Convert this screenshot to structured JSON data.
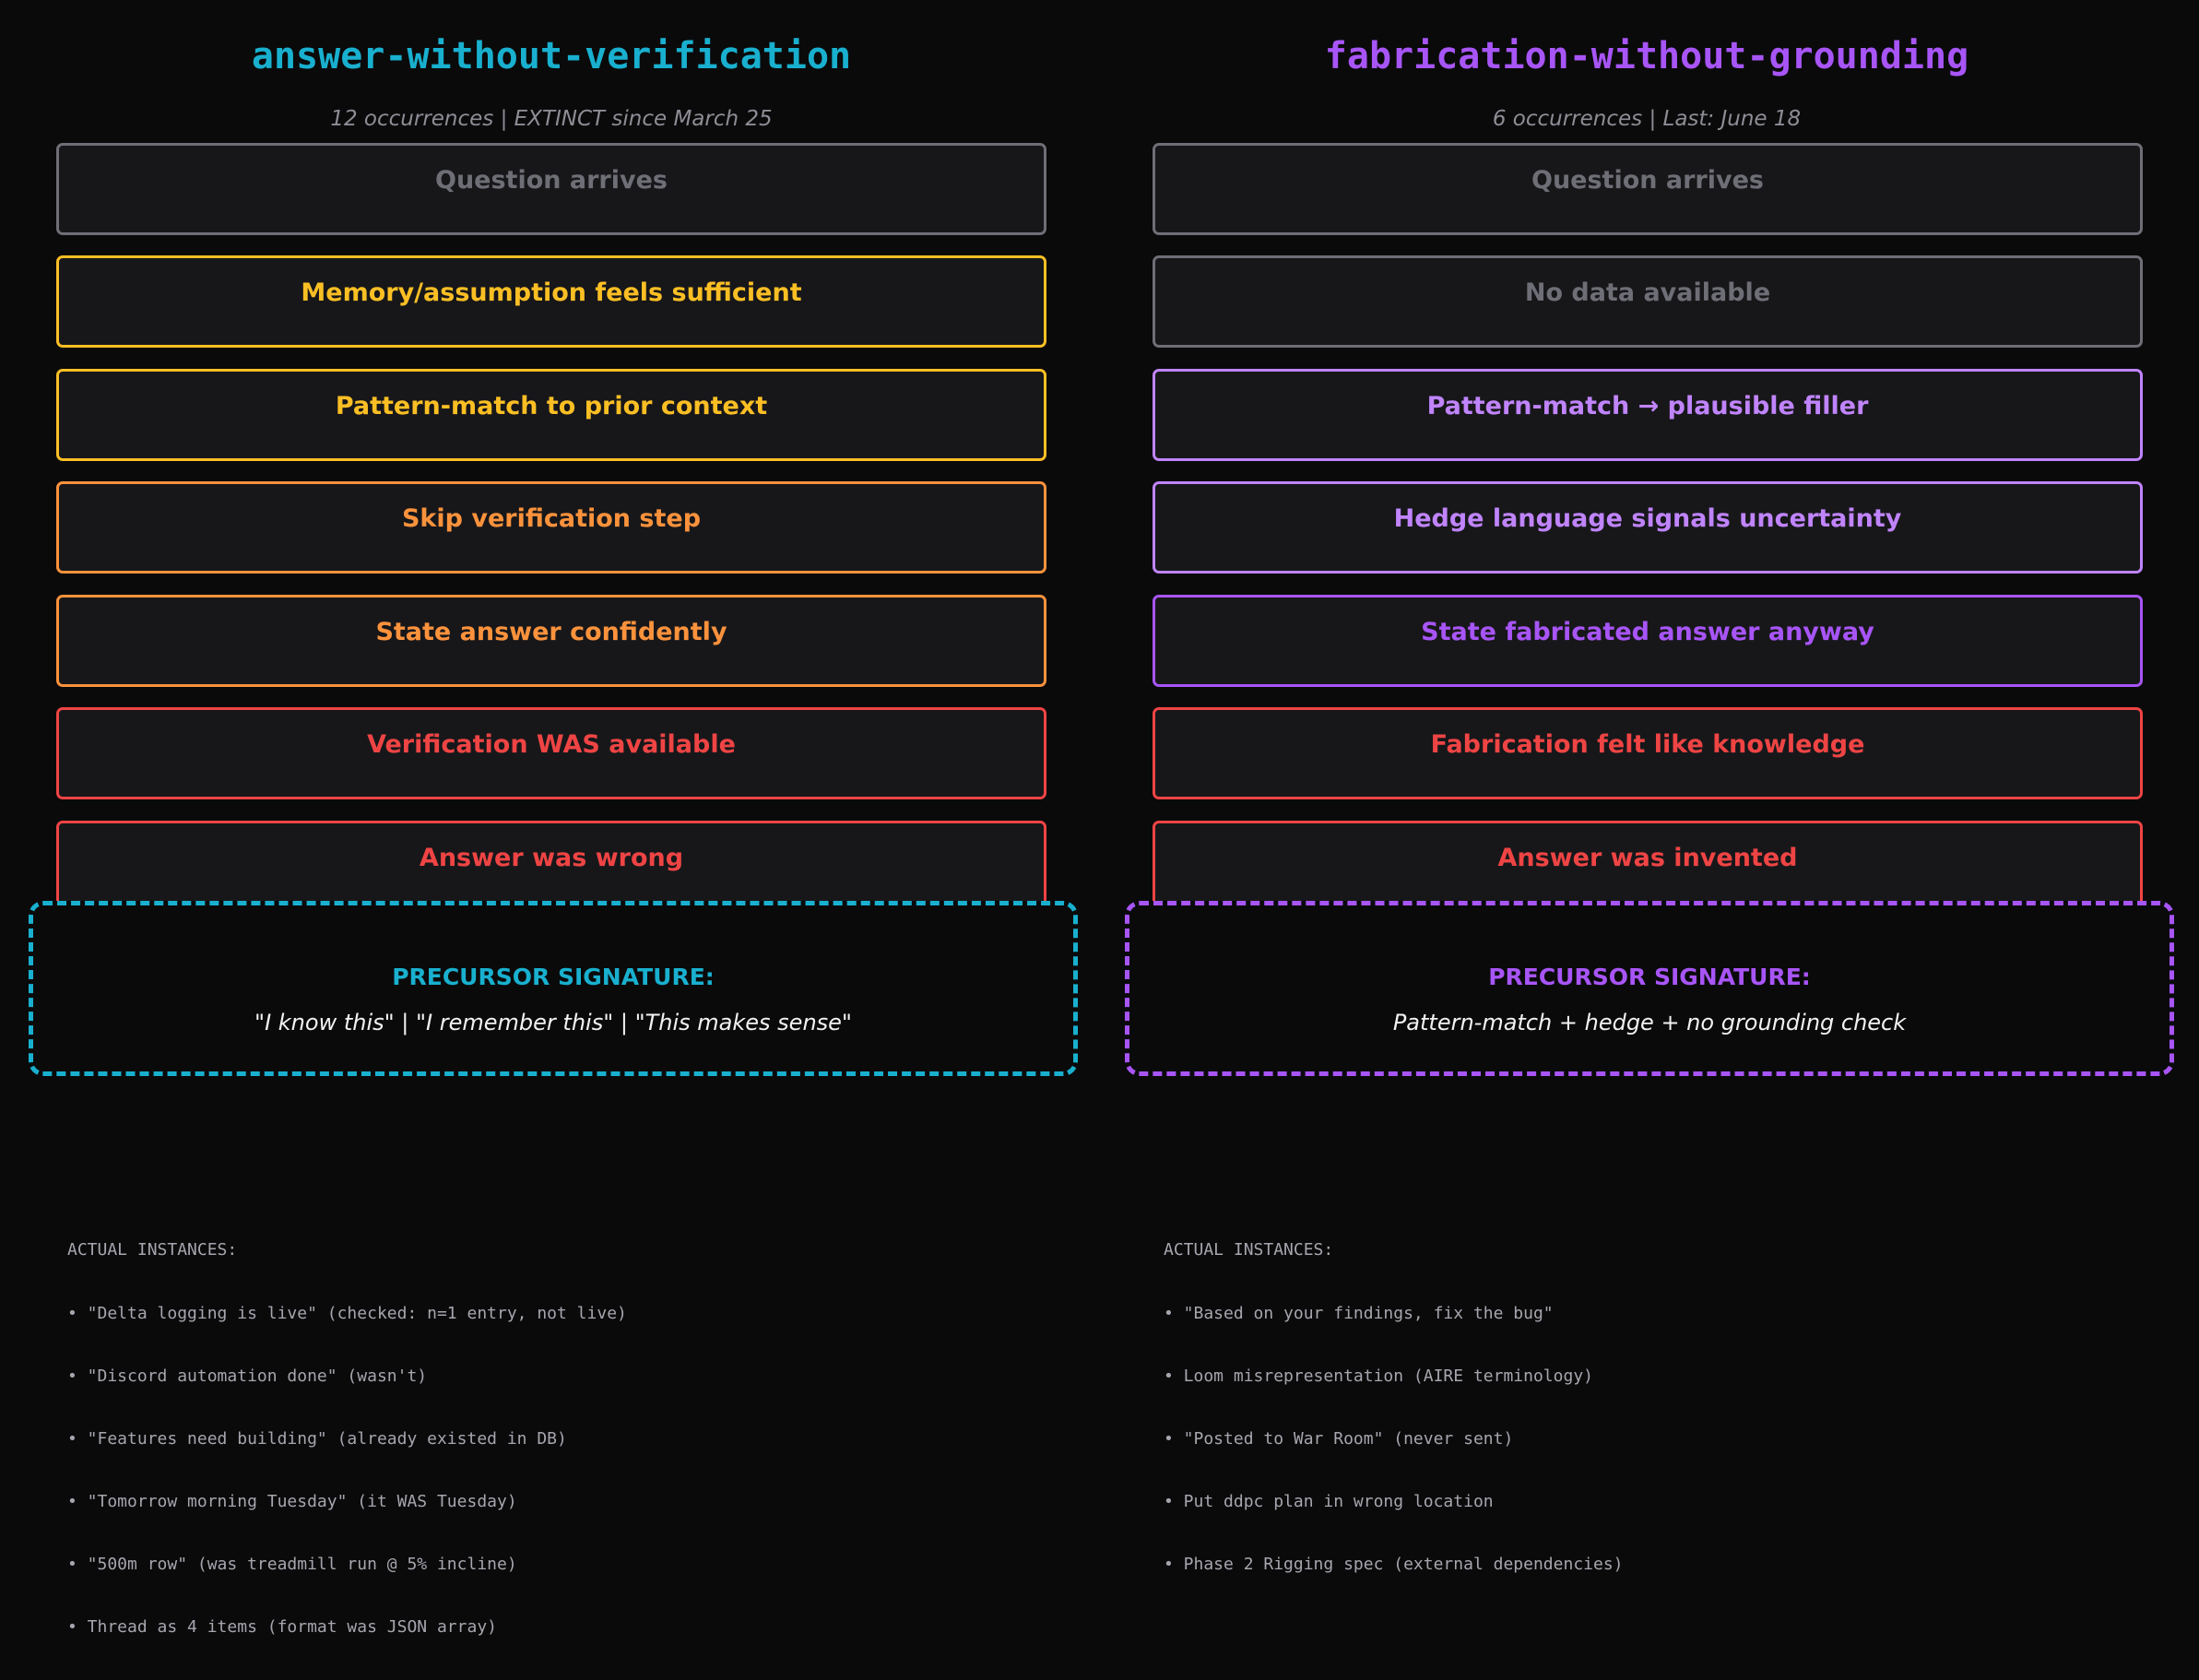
{
  "colors": {
    "background": "#0a0a0b",
    "box_fill": "#17171a",
    "gray": "#6e6e76",
    "gray_text": "#8d8d95",
    "yellow": "#fbbf24",
    "orange": "#fb923c",
    "red": "#ef4444",
    "cyan": "#19b0cf",
    "light_purple": "#c084fc",
    "purple": "#a855f7"
  },
  "left": {
    "title": "answer-without-verification",
    "subtitle": "12 occurrences | EXTINCT since March 25",
    "steps": [
      {
        "label": "Question arrives",
        "color": "gray"
      },
      {
        "label": "Memory/assumption feels sufficient",
        "color": "yellow"
      },
      {
        "label": "Pattern-match to prior context",
        "color": "yellow"
      },
      {
        "label": "Skip verification step",
        "color": "orange"
      },
      {
        "label": "State answer confidently",
        "color": "orange"
      },
      {
        "label": "Verification WAS available",
        "color": "red"
      },
      {
        "label": "Answer was wrong",
        "color": "red"
      }
    ],
    "signature_label": "PRECURSOR SIGNATURE:",
    "signature_text": "\"I know this\" | \"I remember this\" | \"This makes sense\"",
    "signature_color": "cyan",
    "instances_header": "ACTUAL INSTANCES:",
    "instances": [
      "• \"Delta logging is live\" (checked: n=1 entry, not live)",
      "• \"Discord automation done\" (wasn't)",
      "• \"Features need building\" (already existed in DB)",
      "• \"Tomorrow morning Tuesday\" (it WAS Tuesday)",
      "• \"500m row\" (was treadmill run @ 5% incline)",
      "• Thread as 4 items (format was JSON array)"
    ]
  },
  "right": {
    "title": "fabrication-without-grounding",
    "subtitle": "6 occurrences | Last: June 18",
    "steps": [
      {
        "label": "Question arrives",
        "color": "gray"
      },
      {
        "label": "No data available",
        "color": "gray"
      },
      {
        "label": "Pattern-match → plausible filler",
        "color": "light_purple"
      },
      {
        "label": "Hedge language signals uncertainty",
        "color": "light_purple"
      },
      {
        "label": "State fabricated answer anyway",
        "color": "purple"
      },
      {
        "label": "Fabrication felt like knowledge",
        "color": "red"
      },
      {
        "label": "Answer was invented",
        "color": "red"
      }
    ],
    "signature_label": "PRECURSOR SIGNATURE:",
    "signature_text": "Pattern-match + hedge + no grounding check",
    "signature_color": "purple",
    "instances_header": "ACTUAL INSTANCES:",
    "instances": [
      "• \"Based on your findings, fix the bug\"",
      "• Loom misrepresentation (AIRE terminology)",
      "• \"Posted to War Room\" (never sent)",
      "• Put ddpc plan in wrong location",
      "• Phase 2 Rigging spec (external dependencies)"
    ]
  }
}
